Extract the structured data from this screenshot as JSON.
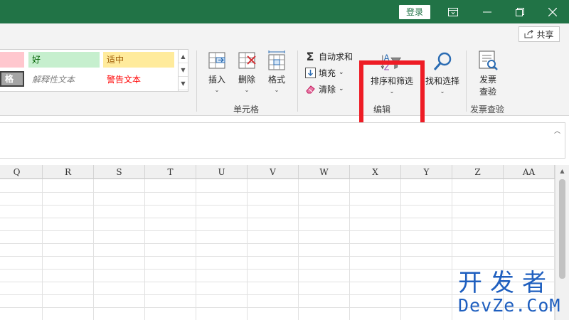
{
  "titlebar": {
    "login_label": "登录",
    "ribbon_display_icon": "ribbon-display-icon",
    "minimize_icon": "minimize-icon",
    "restore_icon": "restore-icon",
    "close_icon": "close-icon",
    "bg_color": "#217346"
  },
  "ribbon": {
    "share_label": "共享",
    "styles_gallery": {
      "row1": [
        "",
        "好",
        "适中"
      ],
      "row2": [
        "格",
        "解释性文本",
        "警告文本"
      ]
    },
    "cells_group": {
      "label": "单元格",
      "insert_label": "插入",
      "delete_label": "删除",
      "format_label": "格式"
    },
    "editing_group": {
      "label": "编辑",
      "autosum_label": "自动求和",
      "fill_label": "填充",
      "clear_label": "清除",
      "sort_filter_label": "排序和筛选",
      "find_select_label": "找和选择"
    },
    "invoice_group": {
      "label": "发票查验",
      "button_line1": "发票",
      "button_line2": "查验"
    },
    "highlight_color": "#ee1c25"
  },
  "sheet": {
    "columns": [
      "Q",
      "R",
      "S",
      "T",
      "U",
      "V",
      "W",
      "X",
      "Y",
      "Z",
      "AA"
    ]
  },
  "watermark": {
    "chinese": "开发者",
    "latin": "DevZe.CoM",
    "color": "#1f5fbf"
  }
}
